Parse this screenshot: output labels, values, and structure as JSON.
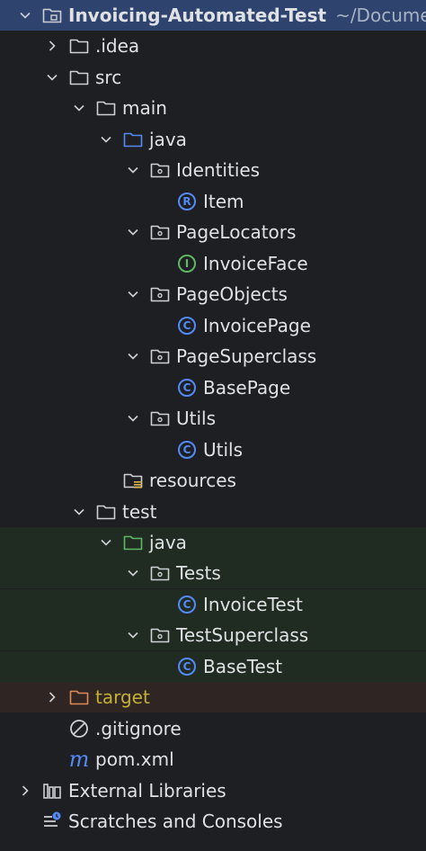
{
  "project": {
    "name": "Invoicing-Automated-Test",
    "path": "~/Documents"
  },
  "tree": {
    "idea": ".idea",
    "src": "src",
    "main": "main",
    "java_main": "java",
    "identities": "Identities",
    "item": "Item",
    "page_locators": "PageLocators",
    "invoice_face": "InvoiceFace",
    "page_objects": "PageObjects",
    "invoice_page": "InvoicePage",
    "page_superclass": "PageSuperclass",
    "base_page": "BasePage",
    "utils_pkg": "Utils",
    "utils_class": "Utils",
    "resources": "resources",
    "test": "test",
    "java_test": "java",
    "tests_pkg": "Tests",
    "invoice_test": "InvoiceTest",
    "test_superclass": "TestSuperclass",
    "base_test": "BaseTest",
    "target": "target",
    "gitignore": ".gitignore",
    "pom": "pom.xml",
    "external_libraries": "External Libraries",
    "scratches": "Scratches and Consoles"
  },
  "icons": {
    "record_letter": "R",
    "interface_letter": "I",
    "class_letter": "C",
    "maven_letter": "m"
  },
  "colors": {
    "background": "#1e1f22",
    "selected_row": "#2e436e",
    "test_sources_bg": "#202b22",
    "excluded_bg": "#2f2623",
    "class_icon_blue": "#548af7",
    "interface_icon_green": "#5fb865",
    "test_folder_green": "#5fb865",
    "target_orange": "#e08855",
    "target_text": "#c3b036"
  }
}
